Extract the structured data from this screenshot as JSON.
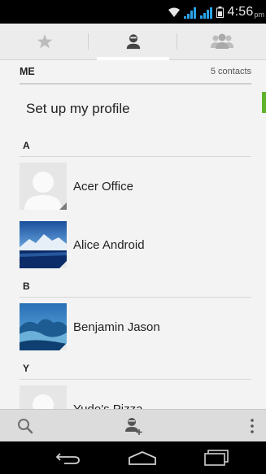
{
  "status_bar": {
    "time": "4:56",
    "ampm": "pm"
  },
  "tabs": [
    {
      "name": "favorites",
      "icon": "star-icon",
      "active": false
    },
    {
      "name": "contacts",
      "icon": "person-icon",
      "active": true
    },
    {
      "name": "groups",
      "icon": "group-icon",
      "active": false
    }
  ],
  "me_section": {
    "label": "ME",
    "count": "5 contacts"
  },
  "profile": {
    "setup_label": "Set up my profile"
  },
  "sections": [
    {
      "letter": "A",
      "contacts": [
        "Acer Office",
        "Alice Android"
      ]
    },
    {
      "letter": "B",
      "contacts": [
        "Benjamin Jason"
      ]
    },
    {
      "letter": "Y",
      "contacts": [
        "Yudo's Pizza"
      ]
    }
  ],
  "action_bar": {
    "search_icon": "search-icon",
    "add_contact_icon": "add-contact-icon",
    "menu_icon": "overflow-menu-icon"
  },
  "nav_bar": {
    "back": "back-icon",
    "home": "home-icon",
    "recents": "recents-icon"
  },
  "colors": {
    "accent_green": "#5fb22b",
    "signal_blue": "#2aa4e8"
  }
}
